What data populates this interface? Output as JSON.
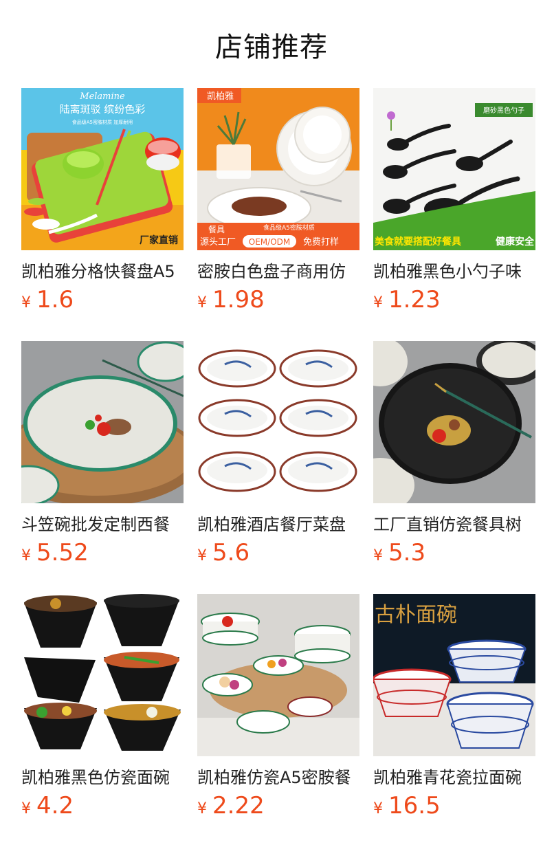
{
  "page": {
    "title": "店铺推荐"
  },
  "currency": "¥",
  "products": [
    {
      "name": "凯柏雅分格快餐盘A5",
      "price": "1.6",
      "image": {
        "top_text": "陆离斑驳 缤纷色彩",
        "script": "Melamine",
        "sub": "食品级A5密胺材质 加厚耐用",
        "badge": "厂家直销"
      }
    },
    {
      "name": "密胺白色盘子商用仿",
      "price": "1.98",
      "image": {
        "brand": "凯柏雅",
        "tag1": "餐具",
        "tag2": "食品级A5密胺材质",
        "tag3": "源头工厂",
        "tag4": "OEM/ODM",
        "tag5": "免费打样"
      }
    },
    {
      "name": "凯柏雅黑色小勺子味",
      "price": "1.23",
      "image": {
        "badge": "磨砂黑色勺子",
        "banner1": "美食就要搭配好餐具",
        "banner2": "健康安全"
      }
    },
    {
      "name": "斗笠碗批发定制西餐",
      "price": "5.52",
      "image": {}
    },
    {
      "name": "凯柏雅酒店餐厅菜盘",
      "price": "5.6",
      "image": {}
    },
    {
      "name": "工厂直销仿瓷餐具树",
      "price": "5.3",
      "image": {}
    },
    {
      "name": "凯柏雅黑色仿瓷面碗",
      "price": "4.2",
      "image": {}
    },
    {
      "name": "凯柏雅仿瓷A5密胺餐",
      "price": "2.22",
      "image": {}
    },
    {
      "name": "凯柏雅青花瓷拉面碗",
      "price": "16.5",
      "image": {
        "title": "古朴面碗"
      }
    }
  ],
  "colors": {
    "price": "#ee4a1b",
    "title": "#111111"
  }
}
